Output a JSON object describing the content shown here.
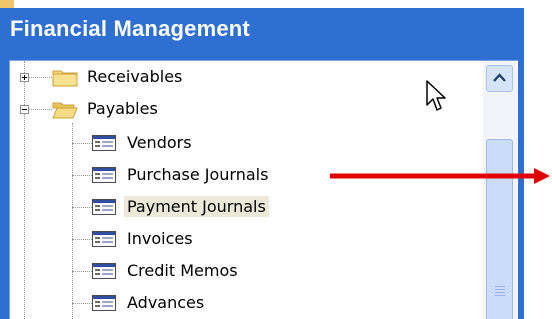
{
  "panel": {
    "title": "Financial Management"
  },
  "tree": {
    "items": [
      {
        "label": "Receivables",
        "icon": "folder-closed-icon",
        "expander": "plus"
      },
      {
        "label": "Payables",
        "icon": "folder-open-icon",
        "expander": "minus"
      },
      {
        "label": "Vendors",
        "icon": "form-icon"
      },
      {
        "label": "Purchase Journals",
        "icon": "form-icon"
      },
      {
        "label": "Payment Journals",
        "icon": "form-icon",
        "selected": true
      },
      {
        "label": "Invoices",
        "icon": "form-icon"
      },
      {
        "label": "Credit Memos",
        "icon": "form-icon"
      },
      {
        "label": "Advances",
        "icon": "form-icon"
      }
    ]
  },
  "colors": {
    "panel_blue": "#2f6fd1",
    "selection": "#ece9d8",
    "annotation_arrow": "#e00000"
  }
}
